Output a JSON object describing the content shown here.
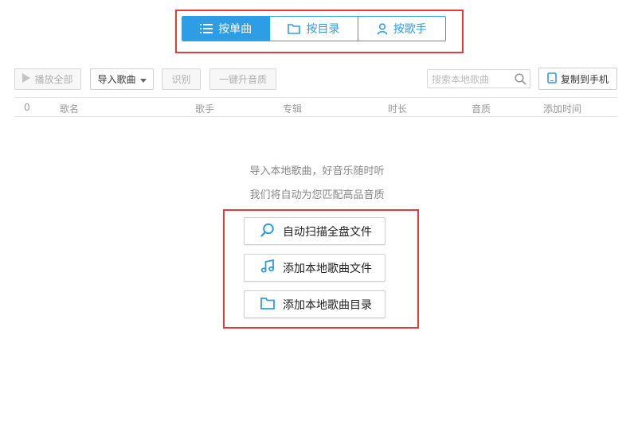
{
  "tabs": [
    {
      "label": "按单曲",
      "active": true,
      "icon": "list-icon"
    },
    {
      "label": "按目录",
      "active": false,
      "icon": "folder-icon"
    },
    {
      "label": "按歌手",
      "active": false,
      "icon": "user-icon"
    }
  ],
  "toolbar": {
    "play_all": "播放全部",
    "import_songs": "导入歌曲",
    "identify": "识别",
    "upgrade_quality": "一键升音质",
    "copy_to_phone": "复制到手机"
  },
  "search": {
    "placeholder": "搜索本地歌曲",
    "value": ""
  },
  "table": {
    "headers": {
      "count": "0",
      "name": "歌名",
      "artist": "歌手",
      "album": "专辑",
      "duration": "时长",
      "quality": "音质",
      "added": "添加时间"
    }
  },
  "empty": {
    "line1": "导入本地歌曲，好音乐随时听",
    "line2": "我们将自动为您匹配高品音质"
  },
  "actions": [
    {
      "label": "自动扫描全盘文件",
      "icon": "search-icon"
    },
    {
      "label": "添加本地歌曲文件",
      "icon": "music-note-icon"
    },
    {
      "label": "添加本地歌曲目录",
      "icon": "folder-icon"
    }
  ],
  "colors": {
    "accent": "#2d9de6",
    "highlight": "#e23b3b"
  }
}
